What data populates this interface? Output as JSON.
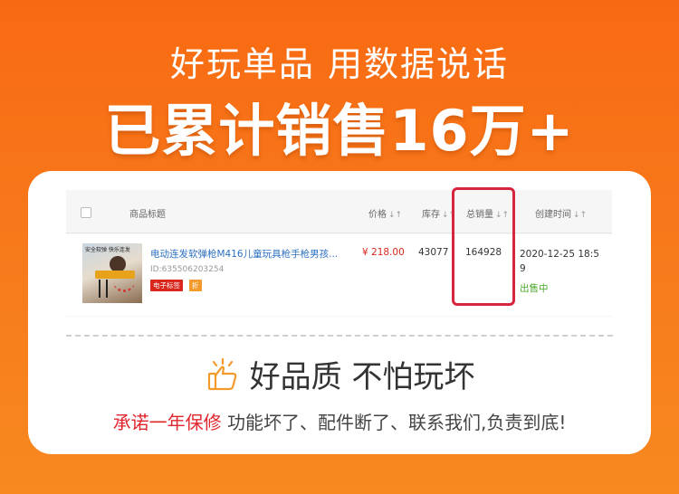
{
  "banner": {
    "subtitle": "好玩单品 用数据说话",
    "headline": "已累计销售16万+"
  },
  "table": {
    "columns": {
      "title": "商品标题",
      "price": "价格",
      "stock": "库存",
      "sales": "总销量",
      "created": "创建时间"
    },
    "sort_icon": "sort-icon",
    "rows": [
      {
        "thumb_text": "安全软弹 快乐连发",
        "title": "电动连发软弹枪M416儿童玩具枪手枪男孩...",
        "id": "ID:635506203254",
        "badge_1": "电子标签",
        "badge_2": "折",
        "price": "¥ 218.00",
        "stock": "43077",
        "sales": "164928",
        "created": "2020-12-25 18:59",
        "status": "出售中"
      }
    ]
  },
  "footer": {
    "quality_text": "好品质 不怕玩坏",
    "promise_highlight": "承诺一年保修",
    "promise_rest": " 功能坏了、配件断了、联系我们,负责到底!"
  },
  "colors": {
    "banner_orange": "#f86a12",
    "highlight_red": "#d8253e",
    "price_red": "#d9261c",
    "status_green": "#4aa82a",
    "link_blue": "#2c6fc2"
  }
}
